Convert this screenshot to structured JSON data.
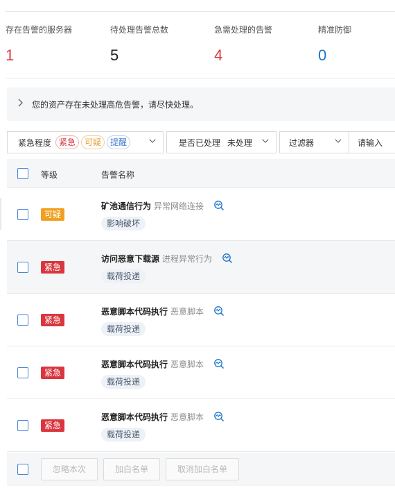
{
  "stats": [
    {
      "label": "存在告警的服务器",
      "value": "1",
      "color": "#d9363e"
    },
    {
      "label": "待处理告警总数",
      "value": "5",
      "color": "#222222"
    },
    {
      "label": "急需处理的告警",
      "value": "4",
      "color": "#d9363e"
    },
    {
      "label": "精准防御",
      "value": "0",
      "color": "#1a74c9"
    }
  ],
  "notice": {
    "text": "您的资产存在未处理高危告警，请尽快处理。",
    "icon": "chevron-right-icon"
  },
  "filters": {
    "severity": {
      "label": "紧急程度",
      "tags": [
        "紧急",
        "可疑",
        "提醒"
      ]
    },
    "handled": {
      "label": "是否已处理",
      "value": "未处理"
    },
    "filter": {
      "label": "过滤器"
    },
    "search": {
      "placeholder": "请输入"
    }
  },
  "table": {
    "headers": {
      "level": "等级",
      "name": "告警名称"
    },
    "rows": [
      {
        "level": "可疑",
        "level_type": "suspicious",
        "name": "矿池通信行为",
        "category": "异常网络连接",
        "tag": "影响破坏"
      },
      {
        "level": "紧急",
        "level_type": "urgent",
        "name": "访问恶意下载源",
        "category": "进程异常行为",
        "tag": "载荷投递"
      },
      {
        "level": "紧急",
        "level_type": "urgent",
        "name": "恶意脚本代码执行",
        "category": "恶意脚本",
        "tag": "载荷投递"
      },
      {
        "level": "紧急",
        "level_type": "urgent",
        "name": "恶意脚本代码执行",
        "category": "恶意脚本",
        "tag": "载荷投递"
      },
      {
        "level": "紧急",
        "level_type": "urgent",
        "name": "恶意脚本代码执行",
        "category": "恶意脚本",
        "tag": "载荷投递"
      }
    ]
  },
  "footer": {
    "ignore_label": "忽略本次",
    "whitelist_label": "加白名单",
    "unwhitelist_label": "取消加白名单"
  },
  "colors": {
    "urgent": "#d9363e",
    "suspicious": "#f0a020",
    "info": "#3a7bd5",
    "accent": "#1a74c9"
  }
}
